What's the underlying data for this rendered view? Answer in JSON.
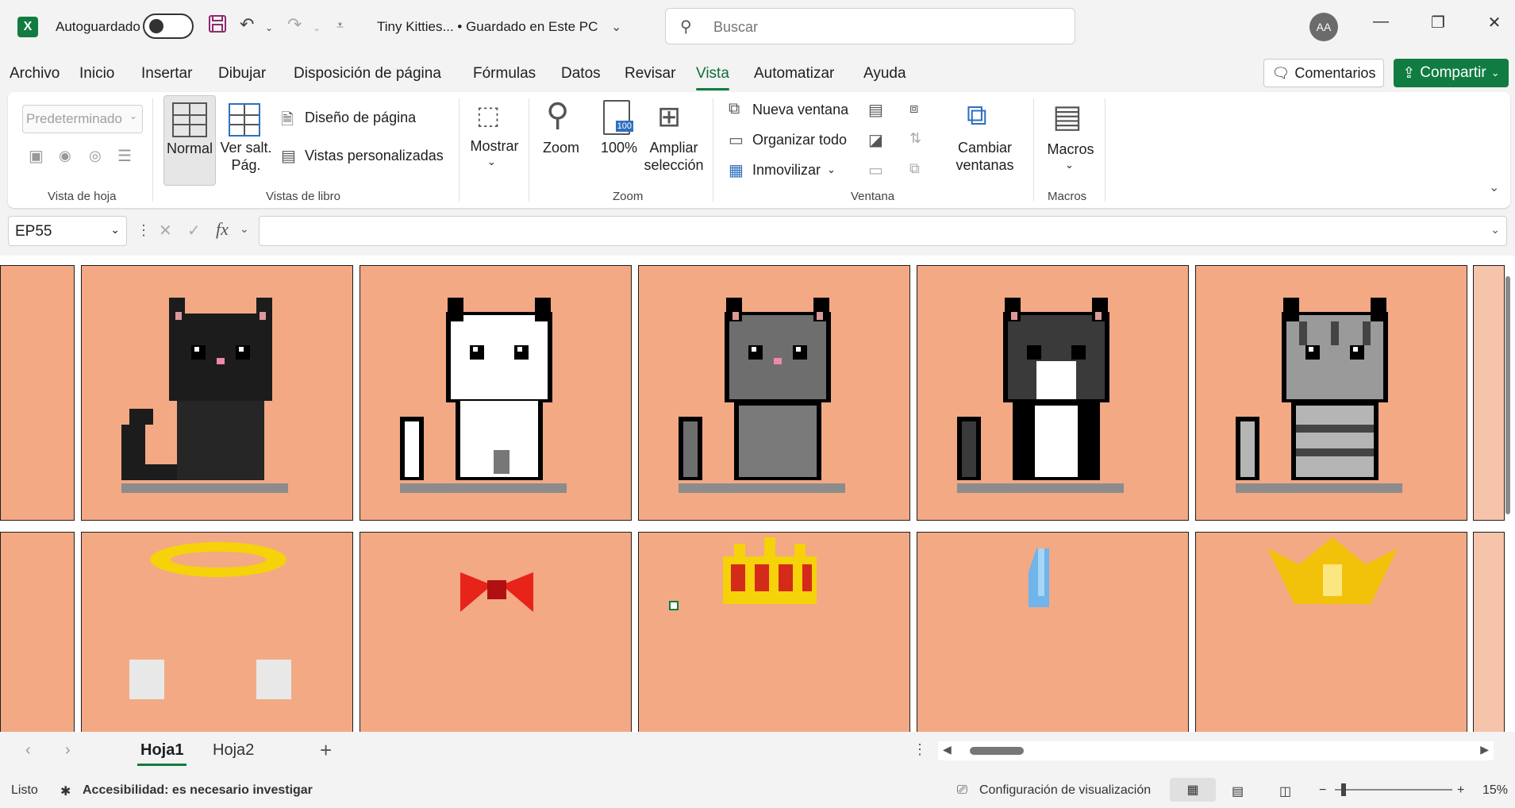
{
  "titlebar": {
    "app_logo": "X",
    "autosave_label": "Autoguardado",
    "doc_title": "Tiny Kitties...  •  Guardado en Este PC",
    "search_placeholder": "Buscar",
    "avatar_initials": "AA"
  },
  "menu": {
    "tabs": [
      "Archivo",
      "Inicio",
      "Insertar",
      "Dibujar",
      "Disposición de página",
      "Fórmulas",
      "Datos",
      "Revisar",
      "Vista",
      "Automatizar",
      "Ayuda"
    ],
    "active_tab": "Vista",
    "comments_label": "Comentarios",
    "share_label": "Compartir"
  },
  "ribbon": {
    "sheet_view_select": "Predeterminado",
    "groups": {
      "sheet_view": "Vista de hoja",
      "workbook_views": "Vistas de libro",
      "zoom": "Zoom",
      "window": "Ventana",
      "macros": "Macros"
    },
    "workbook_views": {
      "normal": "Normal",
      "page_break": "Ver salt.\nPág.",
      "page_layout": "Diseño de página",
      "custom_views": "Vistas personalizadas"
    },
    "show": "Mostrar",
    "zoom": {
      "zoom": "Zoom",
      "hundred": "100%",
      "zoom_selection": "Ampliar\nselección",
      "hundred_icon": "100"
    },
    "window": {
      "new_window": "Nueva ventana",
      "arrange_all": "Organizar todo",
      "freeze": "Inmovilizar",
      "switch_windows": "Cambiar\nventanas"
    },
    "macros": "Macros"
  },
  "formula_bar": {
    "name_box": "EP55",
    "formula": ""
  },
  "sheet": {
    "cell_fill": "#f2a984",
    "top_row": [
      "black-cat",
      "white-cat",
      "gray-cat",
      "tuxedo-cat",
      "tabby-cat"
    ],
    "bottom_row": [
      "halo-wings",
      "red-bow",
      "crown",
      "blue-crystal",
      "golden-crown"
    ]
  },
  "sheet_tabs": {
    "tabs": [
      "Hoja1",
      "Hoja2"
    ],
    "active": "Hoja1"
  },
  "status": {
    "ready": "Listo",
    "accessibility": "Accesibilidad: es necesario investigar",
    "display_settings": "Configuración de visualización",
    "zoom_level": "15%"
  },
  "colors": {
    "accent": "#107c41",
    "cell": "#f2a984"
  }
}
